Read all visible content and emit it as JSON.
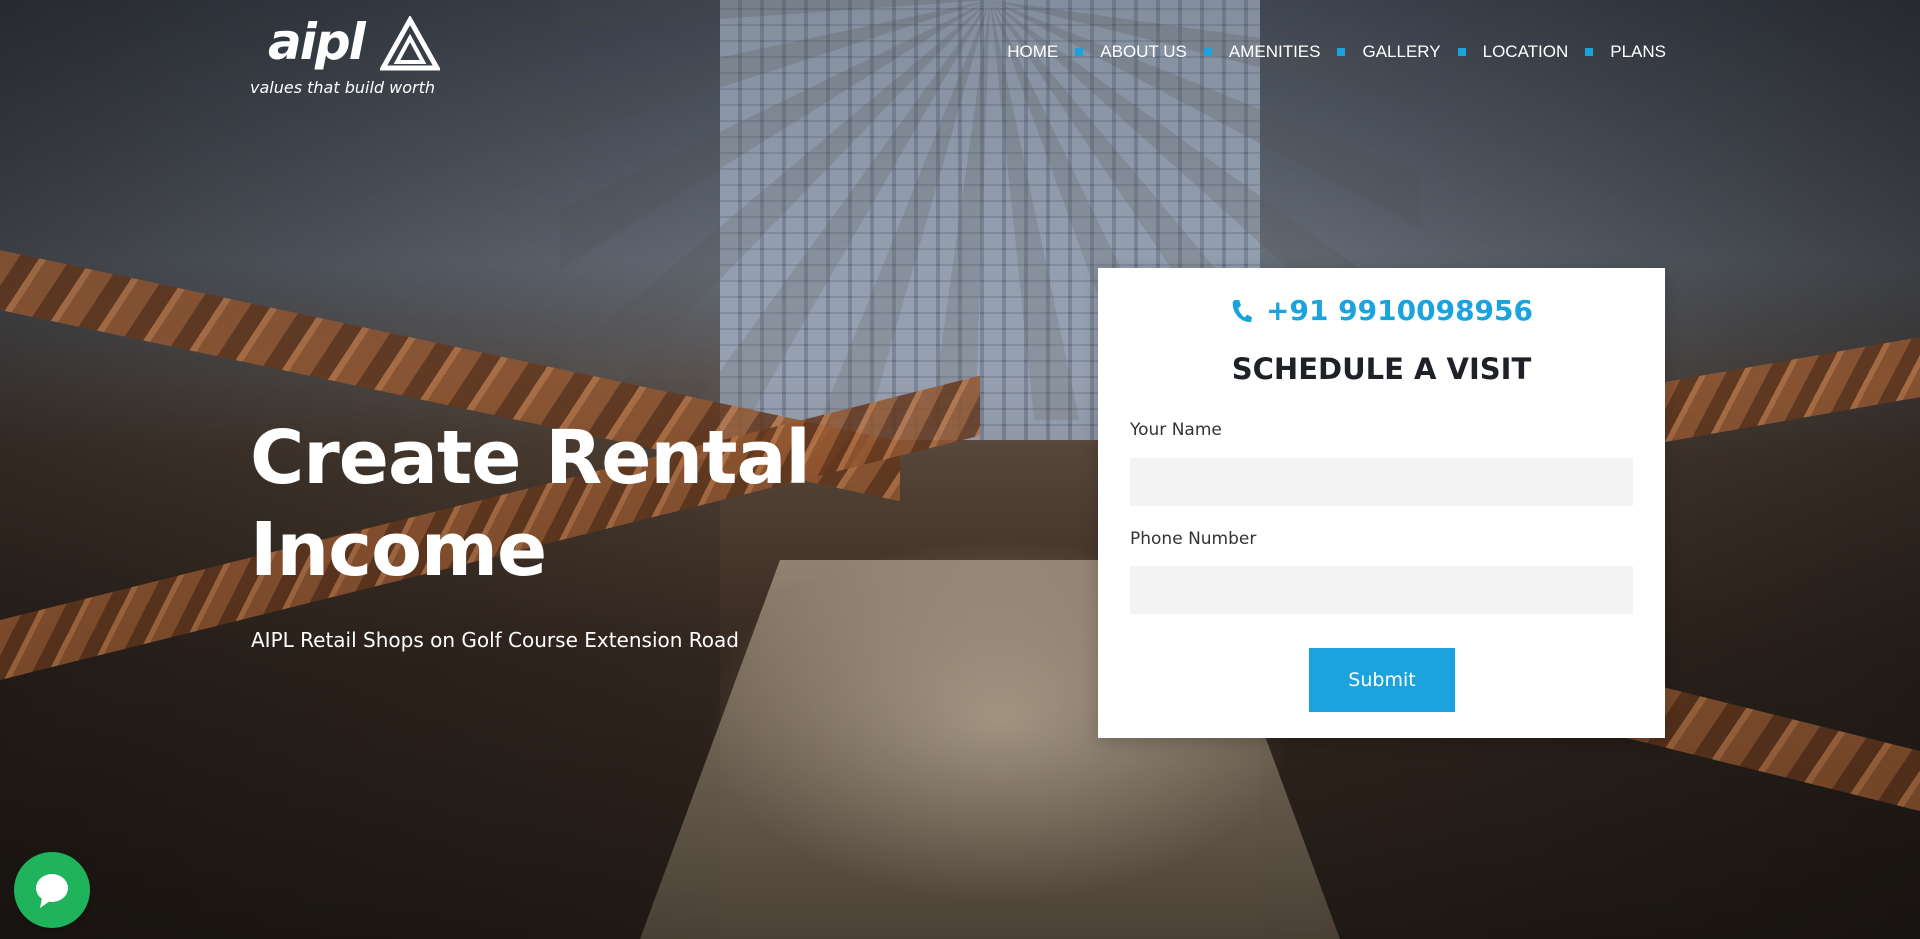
{
  "brand": {
    "logo_text": "aipl",
    "tagline": "values that build worth"
  },
  "nav": {
    "items": [
      {
        "label": "HOME"
      },
      {
        "label": "ABOUT US"
      },
      {
        "label": "AMENITIES"
      },
      {
        "label": "GALLERY"
      },
      {
        "label": "LOCATION"
      },
      {
        "label": "PLANS"
      }
    ]
  },
  "hero": {
    "title_line1": "Create Rental",
    "title_line2": "Income",
    "subtitle": "AIPL Retail Shops on Golf Course Extension Road"
  },
  "form": {
    "phone": "+91 9910098956",
    "title": "SCHEDULE A VISIT",
    "name_label": "Your Name",
    "name_value": "",
    "phone_label": "Phone Number",
    "phone_value": "",
    "submit_label": "Submit"
  },
  "icons": {
    "phone": "phone-icon",
    "chat": "chat-bubble-icon"
  },
  "colors": {
    "accent": "#1aa3dc",
    "chat": "#1fb35b",
    "title_text": "#1e2227",
    "input_bg": "#f3f3f3"
  }
}
